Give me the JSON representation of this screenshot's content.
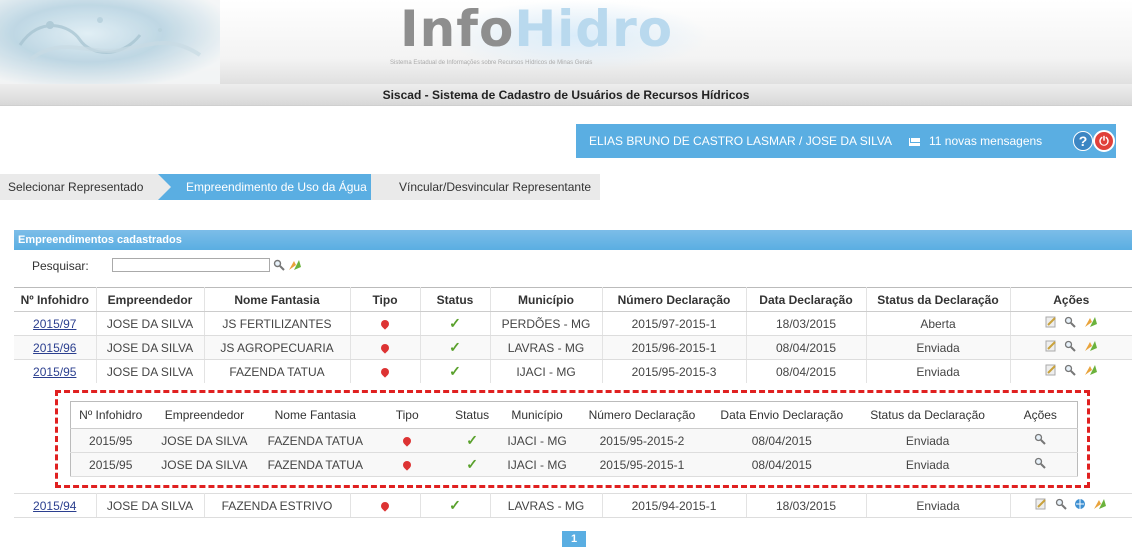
{
  "header": {
    "logo_part1": "Info",
    "logo_part2": "Hidro",
    "logo_subtitle": "Sistema Estadual de Informações sobre Recursos Hídricos de Minas Gerais",
    "system_title": "Siscad - Sistema de Cadastro de Usuários de Recursos Hídricos"
  },
  "userbar": {
    "user": "ELIAS BRUNO DE CASTRO LASMAR  /  JOSE DA SILVA",
    "messages": "11 novas mensagens",
    "help_label": "?",
    "accent": "#5aaee2"
  },
  "tabs": [
    {
      "label": "Selecionar Representado"
    },
    {
      "label": "Empreendimento de Uso da Água"
    },
    {
      "label": "Víncular/Desvincular Representante"
    }
  ],
  "panel": {
    "title": "Empreendimentos cadastrados",
    "search_label": "Pesquisar:",
    "search_value": ""
  },
  "main_table": {
    "headers": [
      "Nº Infohidro",
      "Empreendedor",
      "Nome Fantasia",
      "Tipo",
      "Status",
      "Município",
      "Número Declaração",
      "Data Declaração",
      "Status da Declaração",
      "Ações"
    ],
    "rows": [
      {
        "id": "2015/97",
        "emp": "JOSE DA SILVA",
        "nome": "JS FERTILIZANTES",
        "mun": "PERDÕES - MG",
        "num": "2015/97-2015-1",
        "data": "18/03/2015",
        "status": "Aberta"
      },
      {
        "id": "2015/96",
        "emp": "JOSE DA SILVA",
        "nome": "JS AGROPECUARIA",
        "mun": "LAVRAS - MG",
        "num": "2015/96-2015-1",
        "data": "08/04/2015",
        "status": "Enviada"
      },
      {
        "id": "2015/95",
        "emp": "JOSE DA SILVA",
        "nome": "FAZENDA TATUA",
        "mun": "IJACI - MG",
        "num": "2015/95-2015-3",
        "data": "08/04/2015",
        "status": "Enviada"
      },
      {
        "id": "2015/94",
        "emp": "JOSE DA SILVA",
        "nome": "FAZENDA ESTRIVO",
        "mun": "LAVRAS - MG",
        "num": "2015/94-2015-1",
        "data": "18/03/2015",
        "status": "Enviada"
      }
    ]
  },
  "nested_table": {
    "headers": [
      "Nº Infohidro",
      "Empreendedor",
      "Nome Fantasia",
      "Tipo",
      "Status",
      "Município",
      "Número Declaração",
      "Data Envio Declaração",
      "Status da Declaração",
      "Ações"
    ],
    "rows": [
      {
        "id": "2015/95",
        "emp": "JOSE DA SILVA",
        "nome": "FAZENDA TATUA",
        "mun": "IJACI - MG",
        "num": "2015/95-2015-2",
        "data": "08/04/2015",
        "status": "Enviada"
      },
      {
        "id": "2015/95",
        "emp": "JOSE DA SILVA",
        "nome": "FAZENDA TATUA",
        "mun": "IJACI - MG",
        "num": "2015/95-2015-1",
        "data": "08/04/2015",
        "status": "Enviada"
      }
    ]
  },
  "pagination": {
    "current": "1"
  }
}
